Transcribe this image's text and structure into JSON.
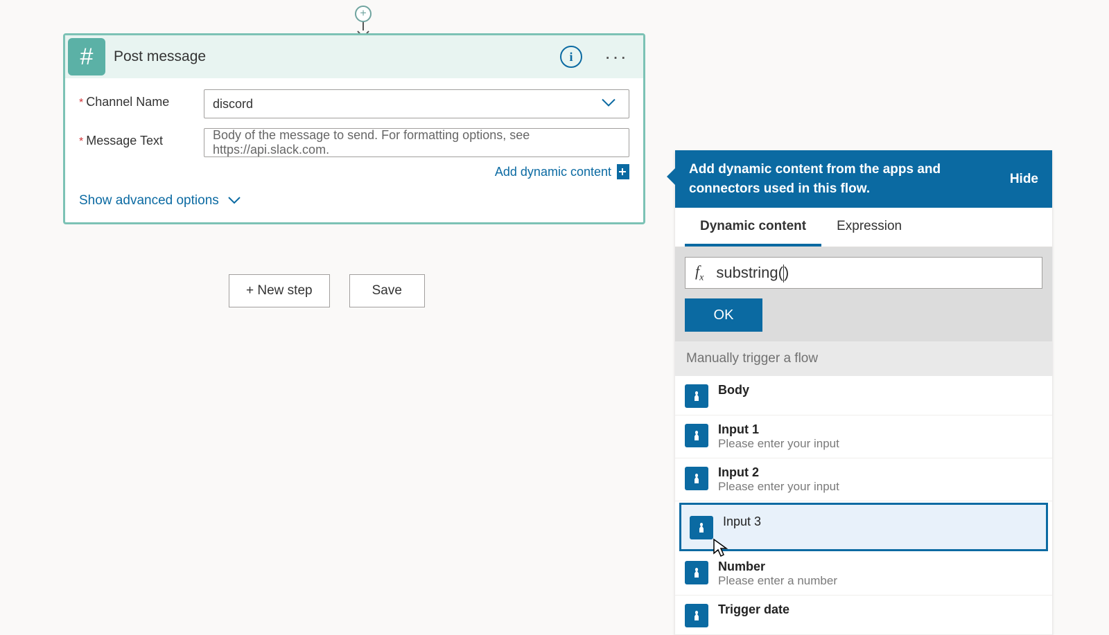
{
  "connector": {
    "plus": "+"
  },
  "card": {
    "hash": "#",
    "title": "Post message",
    "info": "i",
    "more": "···",
    "fields": {
      "channel_label": "Channel Name",
      "channel_value": "discord",
      "message_label": "Message Text",
      "message_placeholder": "Body of the message to send. For formatting options, see https://api.slack.com."
    },
    "add_dynamic": "Add dynamic content",
    "add_dynamic_plus": "+",
    "show_advanced": "Show advanced options"
  },
  "buttons": {
    "new_step": "+ New step",
    "save": "Save"
  },
  "panel": {
    "head_text": "Add dynamic content from the apps and connectors used in this flow.",
    "hide": "Hide",
    "tabs": {
      "dynamic": "Dynamic content",
      "expression": "Expression"
    },
    "fx_value": "substring(",
    "fx_close": ")",
    "ok": "OK",
    "section": "Manually trigger a flow",
    "items": [
      {
        "title": "Body",
        "desc": ""
      },
      {
        "title": "Input 1",
        "desc": "Please enter your input"
      },
      {
        "title": "Input 2",
        "desc": "Please enter your input"
      },
      {
        "title": "Input 3",
        "desc": ""
      },
      {
        "title": "Number",
        "desc": "Please enter a number"
      },
      {
        "title": "Trigger date",
        "desc": ""
      }
    ],
    "highlight_index": 3
  }
}
